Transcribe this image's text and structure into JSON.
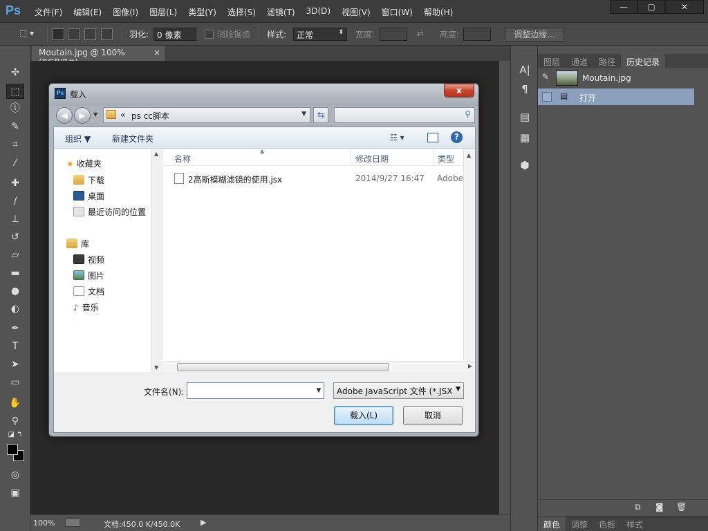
{
  "app": {
    "logo": "Ps"
  },
  "menu": {
    "items": [
      "文件(F)",
      "编辑(E)",
      "图像(I)",
      "图层(L)",
      "类型(Y)",
      "选择(S)",
      "滤镜(T)",
      "3D(D)",
      "视图(V)",
      "窗口(W)",
      "帮助(H)"
    ]
  },
  "window_controls": {
    "minimize": "—",
    "maximize": "▢",
    "close": "✕"
  },
  "options": {
    "feather_label": "羽化:",
    "feather_value": "0 像素",
    "antialias_label": "消除锯齿",
    "style_label": "样式:",
    "style_value": "正常",
    "width_label": "宽度:",
    "height_label": "高度:",
    "refine_edge": "调整边缘..."
  },
  "document": {
    "tab_title": "Moutain.jpg @ 100%(RGB/8#)",
    "tab_close": "×",
    "zoom": "100%",
    "doc_size": "文档:450.0 K/450.0K"
  },
  "history_panel": {
    "tabs": [
      "图层",
      "通道",
      "路径",
      "历史记录"
    ],
    "active_tab": "历史记录",
    "snapshot_name": "Moutain.jpg",
    "steps": [
      "打开"
    ],
    "bottom_tabs": [
      "颜色",
      "调整",
      "色板",
      "样式"
    ]
  },
  "dialog": {
    "title": "载入",
    "close": "x",
    "path_prefix": "«",
    "path": "ps cc脚本",
    "search_placeholder": "",
    "organize": "组织 ▼",
    "new_folder": "新建文件夹",
    "nav": {
      "favorites": "收藏夹",
      "downloads": "下载",
      "desktop": "桌面",
      "recent": "最近访问的位置",
      "libraries": "库",
      "videos": "视频",
      "pictures": "图片",
      "documents": "文档",
      "music": "音乐"
    },
    "columns": {
      "name": "名称",
      "modified": "修改日期",
      "type": "类型"
    },
    "files": [
      {
        "name": "2高斯模糊滤镜的使用.jsx",
        "modified": "2014/9/27 16:47",
        "type": "Adobe"
      }
    ],
    "filename_label": "文件名(N):",
    "filename_value": "",
    "filetype": "Adobe JavaScript 文件 (*.JSX",
    "load_button": "载入(L)",
    "cancel_button": "取消"
  },
  "colors": {
    "accent": "#5aa6e6",
    "history_selected": "#8aa0bd",
    "canvas": "#282828"
  }
}
